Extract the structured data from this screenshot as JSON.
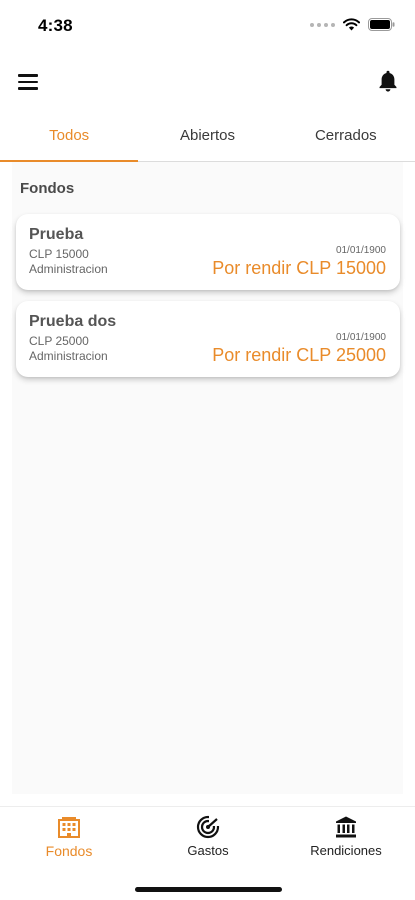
{
  "status_bar": {
    "time": "4:38"
  },
  "tabs": [
    {
      "label": "Todos",
      "active": true
    },
    {
      "label": "Abiertos",
      "active": false
    },
    {
      "label": "Cerrados",
      "active": false
    }
  ],
  "section": {
    "title": "Fondos"
  },
  "funds": [
    {
      "name": "Prueba",
      "amount": "CLP 15000",
      "department": "Administracion",
      "date": "01/01/1900",
      "status": "Por rendir CLP 15000"
    },
    {
      "name": "Prueba dos",
      "amount": "CLP 25000",
      "department": "Administracion",
      "date": "01/01/1900",
      "status": "Por rendir CLP 25000"
    }
  ],
  "bottom_nav": [
    {
      "label": "Fondos",
      "icon": "building-icon",
      "active": true
    },
    {
      "label": "Gastos",
      "icon": "radar-icon",
      "active": false
    },
    {
      "label": "Rendiciones",
      "icon": "bank-icon",
      "active": false
    }
  ],
  "colors": {
    "accent": "#e98b2a",
    "background": "#fafafa"
  }
}
